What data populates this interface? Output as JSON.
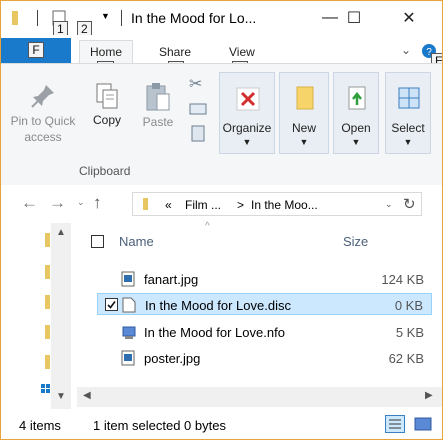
{
  "window": {
    "title": "In the Mood for Lo...",
    "minimize": "—",
    "maximize": "☐",
    "close": "✕"
  },
  "qat": {
    "keytip_1": "1",
    "keytip_2": "2",
    "sep": "|"
  },
  "ribbon_tabs": {
    "file": "File",
    "file_keytip": "F",
    "home": "Home",
    "home_keytip": "H",
    "share": "Share",
    "share_keytip": "S",
    "view": "View",
    "view_keytip": "V",
    "help_keytip": "E"
  },
  "ribbon": {
    "pin_label": "Pin to Quick access",
    "copy_label": "Copy",
    "paste_label": "Paste",
    "clipboard_group": "Clipboard",
    "organize_label": "Organize",
    "new_label": "New",
    "open_label": "Open",
    "select_label": "Select"
  },
  "address": {
    "crumb_overflow": "«",
    "crumb_1": "Film ...",
    "crumb_sep": ">",
    "crumb_2": "In the Moo..."
  },
  "columns": {
    "name": "Name",
    "size": "Size"
  },
  "files": [
    {
      "name": "fanart.jpg",
      "size": "124 KB",
      "icon": "image-file-icon"
    },
    {
      "name": "In the Mood for Love.disc",
      "size": "0 KB",
      "icon": "blank-file-icon",
      "selected": true
    },
    {
      "name": "In the Mood for Love.nfo",
      "size": "5 KB",
      "icon": "nfo-file-icon"
    },
    {
      "name": "poster.jpg",
      "size": "62 KB",
      "icon": "image-file-icon"
    }
  ],
  "status": {
    "items": "4 items",
    "selection": "1 item selected  0 bytes"
  },
  "colors": {
    "accent": "#1979ca",
    "selection_bg": "#cce8ff",
    "window_border": "#e8a33a"
  }
}
